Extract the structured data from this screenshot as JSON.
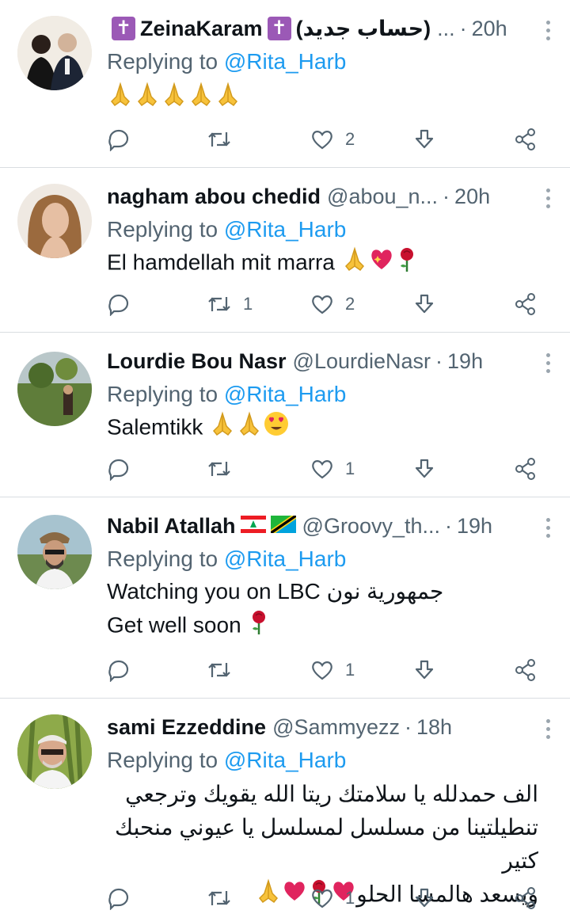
{
  "colors": {
    "accent": "#1d9bf0",
    "muted": "#536471",
    "divider": "#d9dde1"
  },
  "tweets": [
    {
      "name": "ZeinaKaram",
      "name_prefix_badge": "✝",
      "name_suffix_badge": "✝",
      "name_extra": "(حساب جديد)",
      "handle": "...",
      "time": "20h",
      "replying_label": "Replying to",
      "mention": "@Rita_Harb",
      "text": "",
      "emojis": [
        "pray",
        "pray",
        "pray",
        "pray",
        "pray"
      ],
      "stats": {
        "replies": "",
        "retweets": "",
        "likes": "2"
      }
    },
    {
      "name": "nagham abou chedid",
      "handle": "@abou_n...",
      "time": "20h",
      "replying_label": "Replying to",
      "mention": "@Rita_Harb",
      "text": "El hamdellah mit marra",
      "emojis": [
        "pray",
        "heart-sparkle",
        "rose"
      ],
      "stats": {
        "replies": "",
        "retweets": "1",
        "likes": "2"
      }
    },
    {
      "name": "Lourdie Bou Nasr",
      "handle": "@LourdieNasr",
      "time": "19h",
      "replying_label": "Replying to",
      "mention": "@Rita_Harb",
      "text": "Salemtikk",
      "emojis": [
        "pray",
        "pray",
        "heart-eyes"
      ],
      "stats": {
        "replies": "",
        "retweets": "",
        "likes": "1"
      }
    },
    {
      "name": "Nabil Atallah",
      "handle": "@Groovy_th...",
      "time": "19h",
      "replying_label": "Replying to",
      "mention": "@Rita_Harb",
      "text_line1": "Watching you on LBC جمهورية نون",
      "text_line2": "Get well soon",
      "emojis": [
        "rose"
      ],
      "stats": {
        "replies": "",
        "retweets": "",
        "likes": "1"
      }
    },
    {
      "name": "sami Ezzeddine",
      "handle": "@Sammyezz",
      "time": "18h",
      "replying_label": "Replying to",
      "mention": "@Rita_Harb",
      "text_line1": "الف حمدلله يا سلامتك ريتا الله يقويك وترجعي",
      "text_line2": "تنطيلتينا من مسلسل لمسلسل يا عيوني منحبك كتير",
      "text_line3": "ويسعد هالمسا الحلو",
      "emojis": [
        "red-heart",
        "rose",
        "red-heart",
        "pray"
      ],
      "stats": {
        "replies": "",
        "retweets": "",
        "likes": "1"
      }
    }
  ]
}
